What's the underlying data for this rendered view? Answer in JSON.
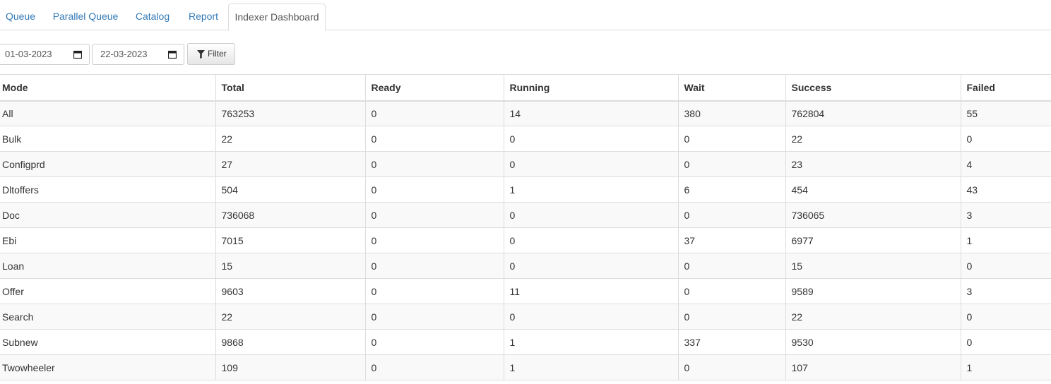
{
  "tabs": [
    {
      "label": "Queue",
      "active": false
    },
    {
      "label": "Parallel Queue",
      "active": false
    },
    {
      "label": "Catalog",
      "active": false
    },
    {
      "label": "Report",
      "active": false
    },
    {
      "label": "Indexer Dashboard",
      "active": true
    }
  ],
  "filter": {
    "start_date": "01-03-2023",
    "end_date": "22-03-2023",
    "button_label": "Filter",
    "button_icon": "filter-icon",
    "date_icon": "calendar-icon"
  },
  "table": {
    "columns": [
      "Mode",
      "Total",
      "Ready",
      "Running",
      "Wait",
      "Success",
      "Failed"
    ],
    "rows": [
      [
        "All",
        "763253",
        "0",
        "14",
        "380",
        "762804",
        "55"
      ],
      [
        "Bulk",
        "22",
        "0",
        "0",
        "0",
        "22",
        "0"
      ],
      [
        "Configprd",
        "27",
        "0",
        "0",
        "0",
        "23",
        "4"
      ],
      [
        "Dltoffers",
        "504",
        "0",
        "1",
        "6",
        "454",
        "43"
      ],
      [
        "Doc",
        "736068",
        "0",
        "0",
        "0",
        "736065",
        "3"
      ],
      [
        "Ebi",
        "7015",
        "0",
        "0",
        "37",
        "6977",
        "1"
      ],
      [
        "Loan",
        "15",
        "0",
        "0",
        "0",
        "15",
        "0"
      ],
      [
        "Offer",
        "9603",
        "0",
        "11",
        "0",
        "9589",
        "3"
      ],
      [
        "Search",
        "22",
        "0",
        "0",
        "0",
        "22",
        "0"
      ],
      [
        "Subnew",
        "9868",
        "0",
        "1",
        "337",
        "9530",
        "0"
      ],
      [
        "Twowheeler",
        "109",
        "0",
        "1",
        "0",
        "107",
        "1"
      ]
    ]
  }
}
